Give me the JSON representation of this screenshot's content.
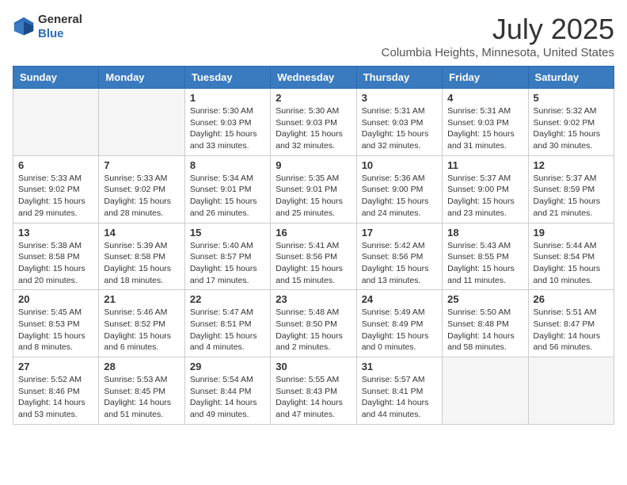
{
  "header": {
    "logo_general": "General",
    "logo_blue": "Blue",
    "month_year": "July 2025",
    "location": "Columbia Heights, Minnesota, United States"
  },
  "weekdays": [
    "Sunday",
    "Monday",
    "Tuesday",
    "Wednesday",
    "Thursday",
    "Friday",
    "Saturday"
  ],
  "weeks": [
    [
      {
        "day": "",
        "info": ""
      },
      {
        "day": "",
        "info": ""
      },
      {
        "day": "1",
        "info": "Sunrise: 5:30 AM\nSunset: 9:03 PM\nDaylight: 15 hours\nand 33 minutes."
      },
      {
        "day": "2",
        "info": "Sunrise: 5:30 AM\nSunset: 9:03 PM\nDaylight: 15 hours\nand 32 minutes."
      },
      {
        "day": "3",
        "info": "Sunrise: 5:31 AM\nSunset: 9:03 PM\nDaylight: 15 hours\nand 32 minutes."
      },
      {
        "day": "4",
        "info": "Sunrise: 5:31 AM\nSunset: 9:03 PM\nDaylight: 15 hours\nand 31 minutes."
      },
      {
        "day": "5",
        "info": "Sunrise: 5:32 AM\nSunset: 9:02 PM\nDaylight: 15 hours\nand 30 minutes."
      }
    ],
    [
      {
        "day": "6",
        "info": "Sunrise: 5:33 AM\nSunset: 9:02 PM\nDaylight: 15 hours\nand 29 minutes."
      },
      {
        "day": "7",
        "info": "Sunrise: 5:33 AM\nSunset: 9:02 PM\nDaylight: 15 hours\nand 28 minutes."
      },
      {
        "day": "8",
        "info": "Sunrise: 5:34 AM\nSunset: 9:01 PM\nDaylight: 15 hours\nand 26 minutes."
      },
      {
        "day": "9",
        "info": "Sunrise: 5:35 AM\nSunset: 9:01 PM\nDaylight: 15 hours\nand 25 minutes."
      },
      {
        "day": "10",
        "info": "Sunrise: 5:36 AM\nSunset: 9:00 PM\nDaylight: 15 hours\nand 24 minutes."
      },
      {
        "day": "11",
        "info": "Sunrise: 5:37 AM\nSunset: 9:00 PM\nDaylight: 15 hours\nand 23 minutes."
      },
      {
        "day": "12",
        "info": "Sunrise: 5:37 AM\nSunset: 8:59 PM\nDaylight: 15 hours\nand 21 minutes."
      }
    ],
    [
      {
        "day": "13",
        "info": "Sunrise: 5:38 AM\nSunset: 8:58 PM\nDaylight: 15 hours\nand 20 minutes."
      },
      {
        "day": "14",
        "info": "Sunrise: 5:39 AM\nSunset: 8:58 PM\nDaylight: 15 hours\nand 18 minutes."
      },
      {
        "day": "15",
        "info": "Sunrise: 5:40 AM\nSunset: 8:57 PM\nDaylight: 15 hours\nand 17 minutes."
      },
      {
        "day": "16",
        "info": "Sunrise: 5:41 AM\nSunset: 8:56 PM\nDaylight: 15 hours\nand 15 minutes."
      },
      {
        "day": "17",
        "info": "Sunrise: 5:42 AM\nSunset: 8:56 PM\nDaylight: 15 hours\nand 13 minutes."
      },
      {
        "day": "18",
        "info": "Sunrise: 5:43 AM\nSunset: 8:55 PM\nDaylight: 15 hours\nand 11 minutes."
      },
      {
        "day": "19",
        "info": "Sunrise: 5:44 AM\nSunset: 8:54 PM\nDaylight: 15 hours\nand 10 minutes."
      }
    ],
    [
      {
        "day": "20",
        "info": "Sunrise: 5:45 AM\nSunset: 8:53 PM\nDaylight: 15 hours\nand 8 minutes."
      },
      {
        "day": "21",
        "info": "Sunrise: 5:46 AM\nSunset: 8:52 PM\nDaylight: 15 hours\nand 6 minutes."
      },
      {
        "day": "22",
        "info": "Sunrise: 5:47 AM\nSunset: 8:51 PM\nDaylight: 15 hours\nand 4 minutes."
      },
      {
        "day": "23",
        "info": "Sunrise: 5:48 AM\nSunset: 8:50 PM\nDaylight: 15 hours\nand 2 minutes."
      },
      {
        "day": "24",
        "info": "Sunrise: 5:49 AM\nSunset: 8:49 PM\nDaylight: 15 hours\nand 0 minutes."
      },
      {
        "day": "25",
        "info": "Sunrise: 5:50 AM\nSunset: 8:48 PM\nDaylight: 14 hours\nand 58 minutes."
      },
      {
        "day": "26",
        "info": "Sunrise: 5:51 AM\nSunset: 8:47 PM\nDaylight: 14 hours\nand 56 minutes."
      }
    ],
    [
      {
        "day": "27",
        "info": "Sunrise: 5:52 AM\nSunset: 8:46 PM\nDaylight: 14 hours\nand 53 minutes."
      },
      {
        "day": "28",
        "info": "Sunrise: 5:53 AM\nSunset: 8:45 PM\nDaylight: 14 hours\nand 51 minutes."
      },
      {
        "day": "29",
        "info": "Sunrise: 5:54 AM\nSunset: 8:44 PM\nDaylight: 14 hours\nand 49 minutes."
      },
      {
        "day": "30",
        "info": "Sunrise: 5:55 AM\nSunset: 8:43 PM\nDaylight: 14 hours\nand 47 minutes."
      },
      {
        "day": "31",
        "info": "Sunrise: 5:57 AM\nSunset: 8:41 PM\nDaylight: 14 hours\nand 44 minutes."
      },
      {
        "day": "",
        "info": ""
      },
      {
        "day": "",
        "info": ""
      }
    ]
  ]
}
